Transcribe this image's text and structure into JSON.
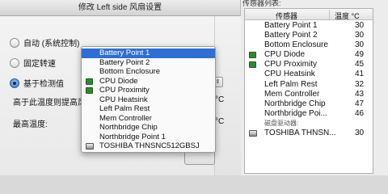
{
  "dialog": {
    "title": "修改 Left side 风扇设置",
    "options": [
      {
        "label": "自动 (系统控制)",
        "selected": false
      },
      {
        "label": "固定转速",
        "selected": false
      },
      {
        "label": "基于检测值",
        "selected": true
      }
    ],
    "threshold_label": "高于此温度则提高风",
    "max_temp_label": "最高温度:",
    "unit1": "°C",
    "unit2": "°C"
  },
  "sensor_menu": {
    "items": [
      {
        "label": "Battery Point 1",
        "icon": "",
        "highlighted": true
      },
      {
        "label": "Battery Point 2",
        "icon": "",
        "highlighted": false
      },
      {
        "label": "Bottom Enclosure",
        "icon": "",
        "highlighted": false
      },
      {
        "label": "CPU Diode",
        "icon": "chip-icon",
        "highlighted": false
      },
      {
        "label": "CPU Proximity",
        "icon": "chip-icon",
        "highlighted": false
      },
      {
        "label": "CPU Heatsink",
        "icon": "",
        "highlighted": false
      },
      {
        "label": "Left Palm Rest",
        "icon": "",
        "highlighted": false
      },
      {
        "label": "Mem Controller",
        "icon": "",
        "highlighted": false
      },
      {
        "label": "Northbridge Chip",
        "icon": "",
        "highlighted": false
      },
      {
        "label": "Northbridge Point 1",
        "icon": "",
        "highlighted": false
      },
      {
        "label": "TOSHIBA THNSNC512GBSJ",
        "icon": "drive-icon",
        "highlighted": false
      }
    ]
  },
  "sensor_panel": {
    "title": "传感器列表:",
    "header_name": "传感器",
    "header_temp": "温度 °C",
    "rows": [
      {
        "name": "Battery Point 1",
        "value": "30"
      },
      {
        "name": "Battery Point 2",
        "value": "30"
      },
      {
        "name": "Bottom Enclosure",
        "value": "30"
      },
      {
        "name": "CPU Diode",
        "value": "49"
      },
      {
        "name": "CPU Proximity",
        "value": "45"
      },
      {
        "name": "CPU Heatsink",
        "value": "41"
      },
      {
        "name": "Left Palm Rest",
        "value": "32"
      },
      {
        "name": "Mem Controller",
        "value": "43"
      },
      {
        "name": "Northbridge Chip",
        "value": "47"
      },
      {
        "name": "Northbridge Poi...",
        "value": "46"
      }
    ],
    "disk_section": "磁盘驱动器:",
    "disk_row": {
      "name": "TOSHIBA THNSN...",
      "value": "30"
    }
  },
  "colors": {
    "highlight": "#2d6fd5",
    "chip_icon": "#2f8a2f"
  }
}
